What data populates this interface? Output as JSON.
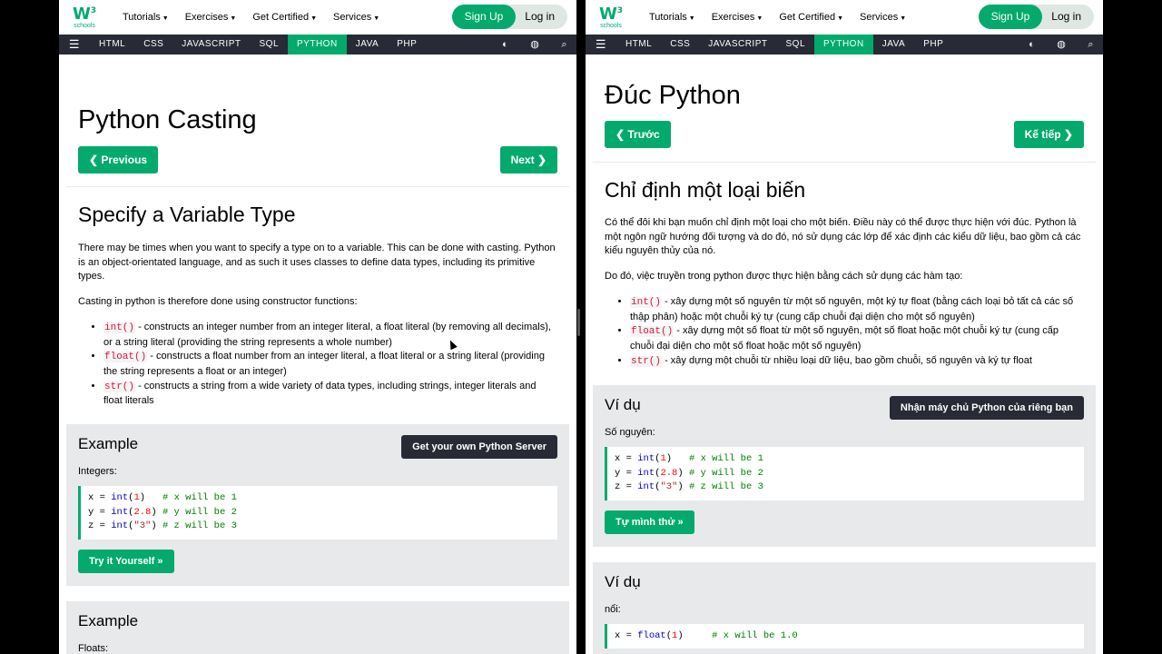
{
  "nav": {
    "logo_mark": "W",
    "logo_sup": "3",
    "logo_word": "schools",
    "menu": [
      {
        "label": "Tutorials"
      },
      {
        "label": "Exercises"
      },
      {
        "label": "Get Certified"
      },
      {
        "label": "Services"
      }
    ],
    "signup": "Sign Up",
    "login": "Log in",
    "langs": [
      "HTML",
      "CSS",
      "JAVASCRIPT",
      "SQL",
      "PYTHON",
      "JAVA",
      "PHP"
    ],
    "active_lang": "PYTHON",
    "accent_color": "#04AA6D",
    "dark_color": "#282A35"
  },
  "left": {
    "title": "Python Casting",
    "prev": "❮ Previous",
    "next": "Next ❯",
    "h2": "Specify a Variable Type",
    "p1": "There may be times when you want to specify a type on to a variable. This can be done with casting. Python is an object-orientated language, and as such it uses classes to define data types, including its primitive types.",
    "p2": "Casting in python is therefore done using constructor functions:",
    "bullets": [
      {
        "code": "int()",
        "text": " - constructs an integer number from an integer literal, a float literal (by removing all decimals), or a string literal (providing the string represents a whole number)"
      },
      {
        "code": "float()",
        "text": " - constructs a float number from an integer literal, a float literal or a string literal (providing the string represents a float or an integer)"
      },
      {
        "code": "str()",
        "text": " - constructs a string from a wide variety of data types, including strings, integer literals and float literals"
      }
    ],
    "example1": {
      "title": "Example",
      "server_btn": "Get your own Python Server",
      "label": "Integers:",
      "lines": [
        {
          "pre": "x = ",
          "fn": "int",
          "open": "(",
          "arg": "1",
          "argtype": "num",
          "close": ")   ",
          "cmt": "# x will be 1"
        },
        {
          "pre": "y = ",
          "fn": "int",
          "open": "(",
          "arg": "2.8",
          "argtype": "num",
          "close": ") ",
          "cmt": "# y will be 2"
        },
        {
          "pre": "z = ",
          "fn": "int",
          "open": "(",
          "arg": "\"3\"",
          "argtype": "str",
          "close": ") ",
          "cmt": "# z will be 3"
        }
      ],
      "try": "Try it Yourself »"
    },
    "example2": {
      "title": "Example",
      "label": "Floats:"
    }
  },
  "right": {
    "title": "Đúc Python",
    "prev": "❮ Trước",
    "next": "Kế tiếp ❯",
    "h2": "Chỉ định một loại biến",
    "p1": "Có thể đôi khi bạn muốn chỉ định một loại cho một biến. Điều này có thể được thực hiện với đúc. Python là một ngôn ngữ hướng đối tượng và do đó, nó sử dụng các lớp để xác định các kiểu dữ liệu, bao gồm cả các kiểu nguyên thủy của nó.",
    "p2": "Do đó, việc truyền trong python được thực hiện bằng cách sử dụng các hàm tạo:",
    "bullets": [
      {
        "code": "int()",
        "text": " - xây dựng một số nguyên từ một số nguyên, một ký tự float (bằng cách loại bỏ tất cả các số thập phân) hoặc một chuỗi ký tự (cung cấp chuỗi đại diện cho một số nguyên)"
      },
      {
        "code": "float()",
        "text": " - xây dựng một số float từ một số nguyên, một số float hoặc một chuỗi ký tự (cung cấp chuỗi đại diện cho một số float hoặc một số nguyên)"
      },
      {
        "code": "str()",
        "text": " - xây dựng một chuỗi từ nhiều loại dữ liệu, bao gồm chuỗi, số nguyên và ký tự float"
      }
    ],
    "example1": {
      "title": "Ví dụ",
      "server_btn": "Nhận máy chủ Python của riêng bạn",
      "label": "Số nguyên:",
      "lines": [
        {
          "pre": "x = ",
          "fn": "int",
          "open": "(",
          "arg": "1",
          "argtype": "num",
          "close": ")   ",
          "cmt": "# x will be 1"
        },
        {
          "pre": "y = ",
          "fn": "int",
          "open": "(",
          "arg": "2.8",
          "argtype": "num",
          "close": ") ",
          "cmt": "# y will be 2"
        },
        {
          "pre": "z = ",
          "fn": "int",
          "open": "(",
          "arg": "\"3\"",
          "argtype": "str",
          "close": ") ",
          "cmt": "# z will be 3"
        }
      ],
      "try": "Tự mình thử »"
    },
    "example2": {
      "title": "Ví dụ",
      "label": "nổi:",
      "line": {
        "pre": "x = ",
        "fn": "float",
        "open": "(",
        "arg": "1",
        "close": ")     ",
        "cmt": "# x will be 1.0"
      }
    }
  }
}
